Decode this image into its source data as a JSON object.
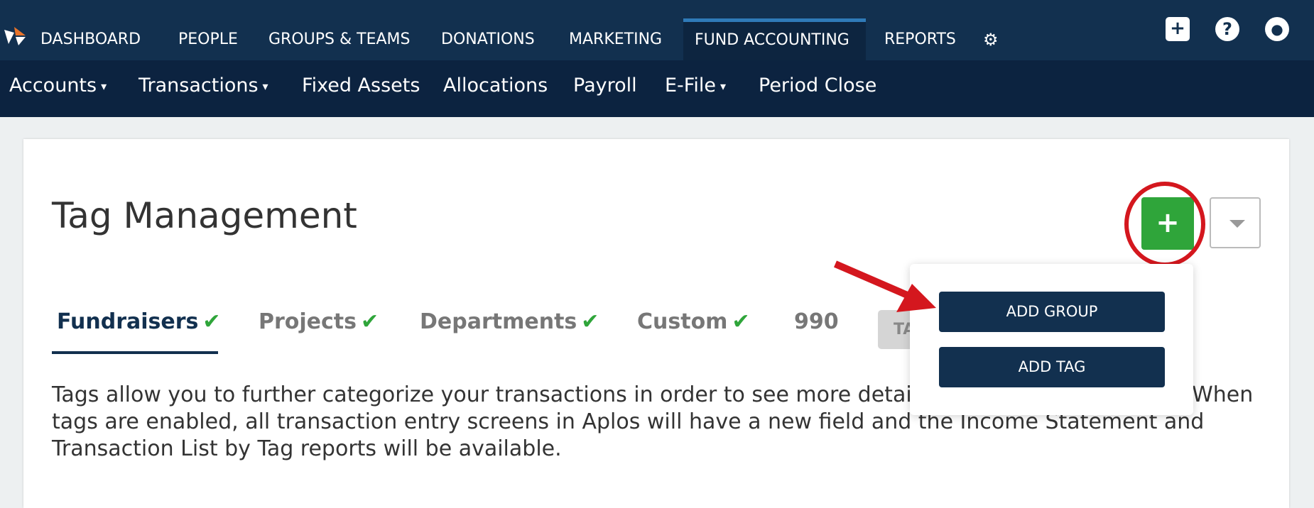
{
  "top_nav": {
    "items": [
      "DASHBOARD",
      "PEOPLE",
      "GROUPS & TEAMS",
      "DONATIONS",
      "MARKETING",
      "FUND ACCOUNTING",
      "REPORTS"
    ],
    "active": "FUND ACCOUNTING",
    "icons": [
      "gear-icon",
      "plus-square-icon",
      "help-icon",
      "user-icon"
    ]
  },
  "sub_nav": {
    "items": [
      "Accounts",
      "Transactions",
      "Fixed Assets",
      "Allocations",
      "Payroll",
      "E-File",
      "Period Close"
    ],
    "caret": "▾"
  },
  "page": {
    "title": "Tag Management",
    "add_label": "+",
    "tabs": [
      {
        "label": "Fundraisers",
        "check": "✔"
      },
      {
        "label": "Projects",
        "check": "✔"
      },
      {
        "label": "Departments",
        "check": "✔"
      },
      {
        "label": "Custom",
        "check": "✔"
      },
      {
        "label": "990",
        "check": ""
      }
    ],
    "tag_button_partial": "TA",
    "description": "Tags allow you to further categorize your transactions in order to see more detail in your financial reports. When tags are enabled, all transaction entry screens in Aplos will have a new field and the Income Statement and Transaction List by Tag reports will be available."
  },
  "menu": {
    "add_group": "ADD GROUP",
    "add_tag": "ADD TAG"
  },
  "colors": {
    "nav": "#12304f",
    "subnav": "#0c2340",
    "green": "#2fa53a",
    "annotation_red": "#d4171e"
  }
}
